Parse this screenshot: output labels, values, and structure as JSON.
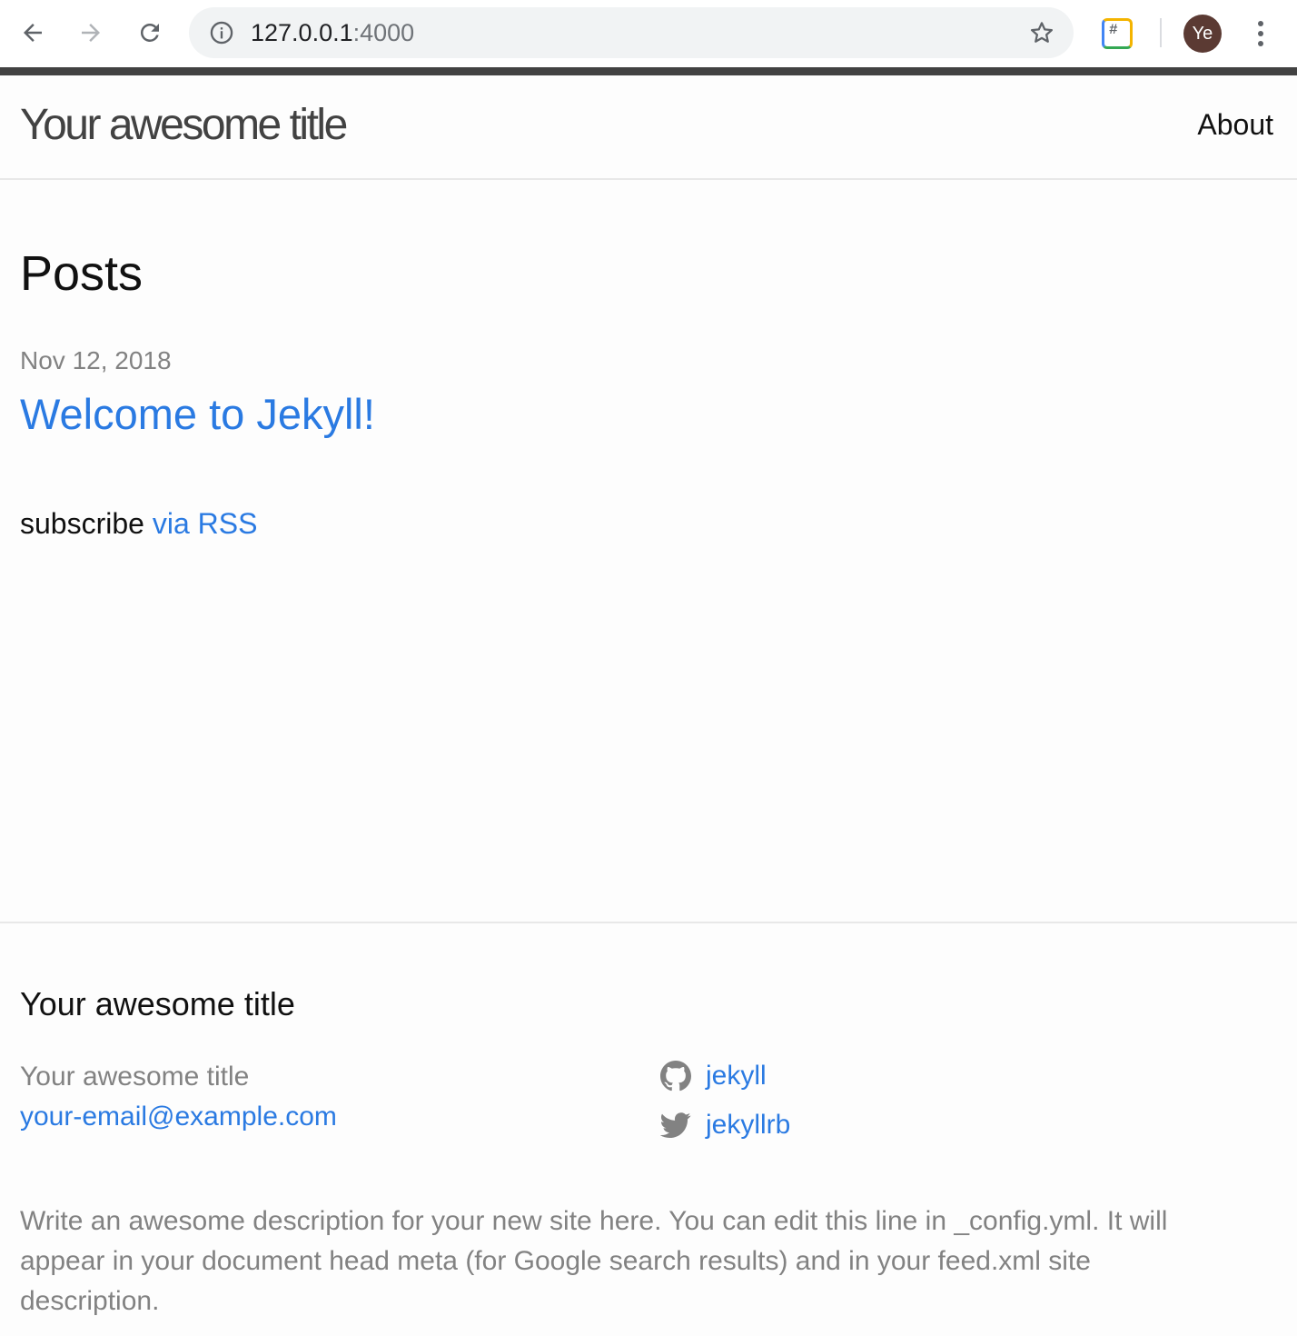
{
  "browser": {
    "url_host": "127.0.0.1",
    "url_port": ":4000",
    "profile_initials": "Ye",
    "extension_glyph": "#",
    "icons": {
      "back": "arrow-left-icon",
      "forward": "arrow-right-icon",
      "reload": "reload-icon",
      "info": "info-icon",
      "bookmark": "star-icon",
      "menu": "kebab-menu-icon"
    }
  },
  "header": {
    "site_title": "Your awesome title",
    "nav": [
      {
        "label": "About"
      }
    ]
  },
  "main": {
    "heading": "Posts",
    "posts": [
      {
        "date": "Nov 12, 2018",
        "title": "Welcome to Jekyll!"
      }
    ],
    "rss_prefix": "subscribe",
    "rss_link": "via RSS"
  },
  "footer": {
    "heading": "Your awesome title",
    "name": "Your awesome title",
    "email": "your-email@example.com",
    "social": [
      {
        "icon": "github-icon",
        "label": "jekyll"
      },
      {
        "icon": "twitter-icon",
        "label": "jekyllrb"
      }
    ],
    "description": "Write an awesome description for your new site here. You can edit this line in _config.yml. It will appear in your document head meta (for Google search results) and in your feed.xml site description."
  },
  "colors": {
    "link": "#2a7ae2",
    "text": "#111111",
    "muted": "#828282",
    "header_bar": "#424242",
    "avatar_bg": "#5b3a33"
  }
}
